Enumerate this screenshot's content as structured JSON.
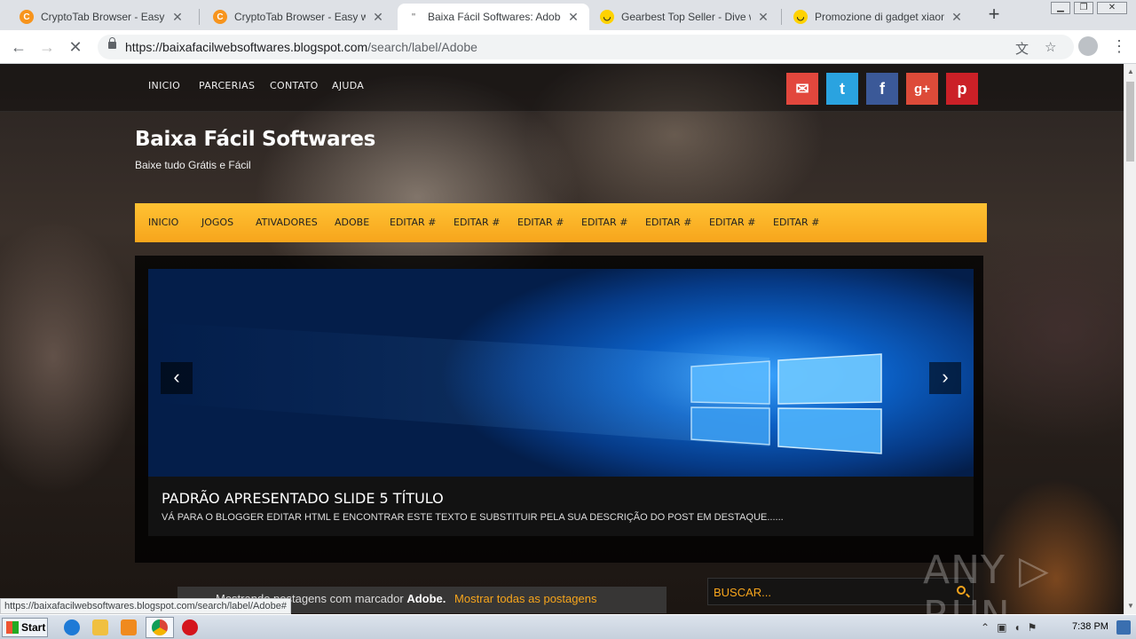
{
  "browser": {
    "tabs": [
      {
        "title": "CryptoTab Browser - Easy way",
        "favicon_color": "#f7941d",
        "active": false
      },
      {
        "title": "CryptoTab Browser - Easy way",
        "favicon_color": "#f7941d",
        "active": false
      },
      {
        "title": "Baixa Fácil Softwares: Adobe",
        "favicon_color": "#888888",
        "active": true
      },
      {
        "title": "Gearbest Top Seller - Dive with",
        "favicon_color": "#ffd200",
        "active": false
      },
      {
        "title": "Promozione di gadget xiaomi fin",
        "favicon_color": "#ffd200",
        "active": false
      }
    ],
    "url_host": "https://baixafacilwebsoftwares.blogspot.com",
    "url_path": "/search/label/Adobe",
    "status_url": "https://baixafacilwebsoftwares.blogspot.com/search/label/Adobe#"
  },
  "site": {
    "topnav": [
      "INICIO",
      "PARCERIAS",
      "CONTATO",
      "AJUDA"
    ],
    "social": [
      {
        "name": "email-icon",
        "color": "#e2473d",
        "glyph": "✉"
      },
      {
        "name": "twitter-icon",
        "color": "#2aa3e0",
        "glyph": "t"
      },
      {
        "name": "facebook-icon",
        "color": "#3b5998",
        "glyph": "f"
      },
      {
        "name": "google-plus-icon",
        "color": "#dd4b39",
        "glyph": "g+"
      },
      {
        "name": "pinterest-icon",
        "color": "#cb2027",
        "glyph": "p"
      }
    ],
    "title": "Baixa Fácil Softwares",
    "description": "Baixe tudo Grátis e Fácil",
    "mainnav": [
      "INICIO",
      "JOGOS",
      "ATIVADORES",
      "ADOBE",
      "EDITAR #",
      "EDITAR #",
      "EDITAR #",
      "EDITAR #",
      "EDITAR #",
      "EDITAR #",
      "EDITAR #"
    ],
    "slide": {
      "title": "PADRÃO APRESENTADO SLIDE 5 TÍTULO",
      "description": "VÁ PARA O BLOGGER EDITAR HTML E ENCONTRAR ESTE TEXTO E SUBSTITUIR PELA SUA DESCRIÇÃO DO POST EM DESTAQUE......",
      "prev_glyph": "‹",
      "next_glyph": "›"
    },
    "label_bar": {
      "prefix": "Mostrando postagens com marcador",
      "label": "Adobe.",
      "show_all": "Mostrar todas as postagens"
    },
    "search": {
      "placeholder": "BUSCAR..."
    },
    "watermark": "ANY ▷ RUN",
    "accent_color": "#f7a51c"
  },
  "taskbar": {
    "start_label": "Start",
    "time": "7:38 PM"
  }
}
